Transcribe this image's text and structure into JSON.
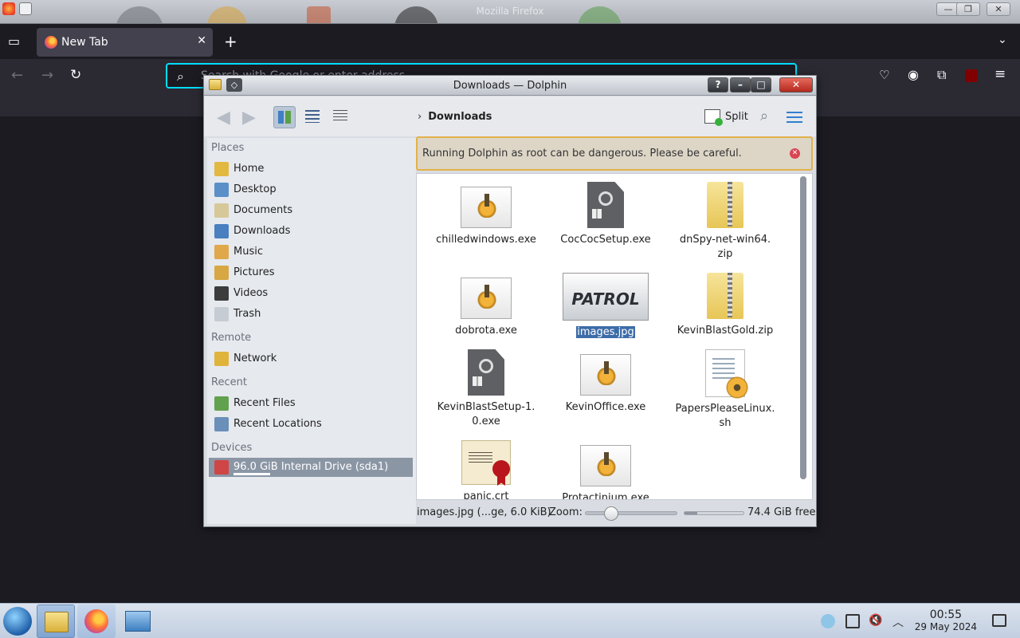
{
  "firefox": {
    "window_title": "Mozilla Firefox",
    "tab_label": "New Tab",
    "tab_close": "✕",
    "new_tab": "+",
    "url_placeholder": "Search with Google or enter address"
  },
  "dolphin": {
    "title": "Downloads — Dolphin",
    "breadcrumb": "Downloads",
    "split_label": "Split",
    "warning": "Running Dolphin as root can be dangerous. Please be careful.",
    "places": {
      "places_heading": "Places",
      "remote_heading": "Remote",
      "recent_heading": "Recent",
      "devices_heading": "Devices",
      "items": [
        {
          "label": "Home",
          "icon": "home-icon"
        },
        {
          "label": "Desktop",
          "icon": "desktop-icon"
        },
        {
          "label": "Documents",
          "icon": "documents-icon"
        },
        {
          "label": "Downloads",
          "icon": "downloads-icon"
        },
        {
          "label": "Music",
          "icon": "music-icon"
        },
        {
          "label": "Pictures",
          "icon": "pictures-icon"
        },
        {
          "label": "Videos",
          "icon": "videos-icon"
        },
        {
          "label": "Trash",
          "icon": "trash-icon"
        }
      ],
      "remote": [
        {
          "label": "Network",
          "icon": "network-icon"
        }
      ],
      "recent": [
        {
          "label": "Recent Files",
          "icon": "recent-files-icon"
        },
        {
          "label": "Recent Locations",
          "icon": "recent-locations-icon"
        }
      ],
      "devices": [
        {
          "label": "96.0 GiB Internal Drive (sda1)",
          "icon": "drive-icon",
          "fill_fraction": 0.2
        }
      ]
    },
    "files": [
      {
        "name": "chilledwindows.exe",
        "type": "exe"
      },
      {
        "name": "CocCocSetup.exe",
        "type": "setup"
      },
      {
        "name": "dnSpy-net-win64.\nzip",
        "type": "zip"
      },
      {
        "name": "dobrota.exe",
        "type": "exe"
      },
      {
        "name": "images.jpg",
        "type": "image",
        "thumb_text": "PATROL",
        "selected": true
      },
      {
        "name": "KevinBlastGold.zip",
        "type": "zip"
      },
      {
        "name": "KevinBlastSetup-1.\n0.exe",
        "type": "setup"
      },
      {
        "name": "KevinOffice.exe",
        "type": "exe"
      },
      {
        "name": "PapersPleaseLinux.\nsh",
        "type": "script"
      },
      {
        "name": "panic.crt",
        "type": "cert"
      },
      {
        "name": "Protactinium.exe",
        "type": "exe"
      }
    ],
    "status": {
      "selection": "images.jpg (...ge, 6.0 KiB)",
      "zoom_label": "Zoom:",
      "zoom_fraction": 0.28,
      "free_space": "74.4 GiB free",
      "used_fraction": 0.22
    }
  },
  "taskbar": {
    "time": "00:55",
    "date": "29 May 2024"
  }
}
